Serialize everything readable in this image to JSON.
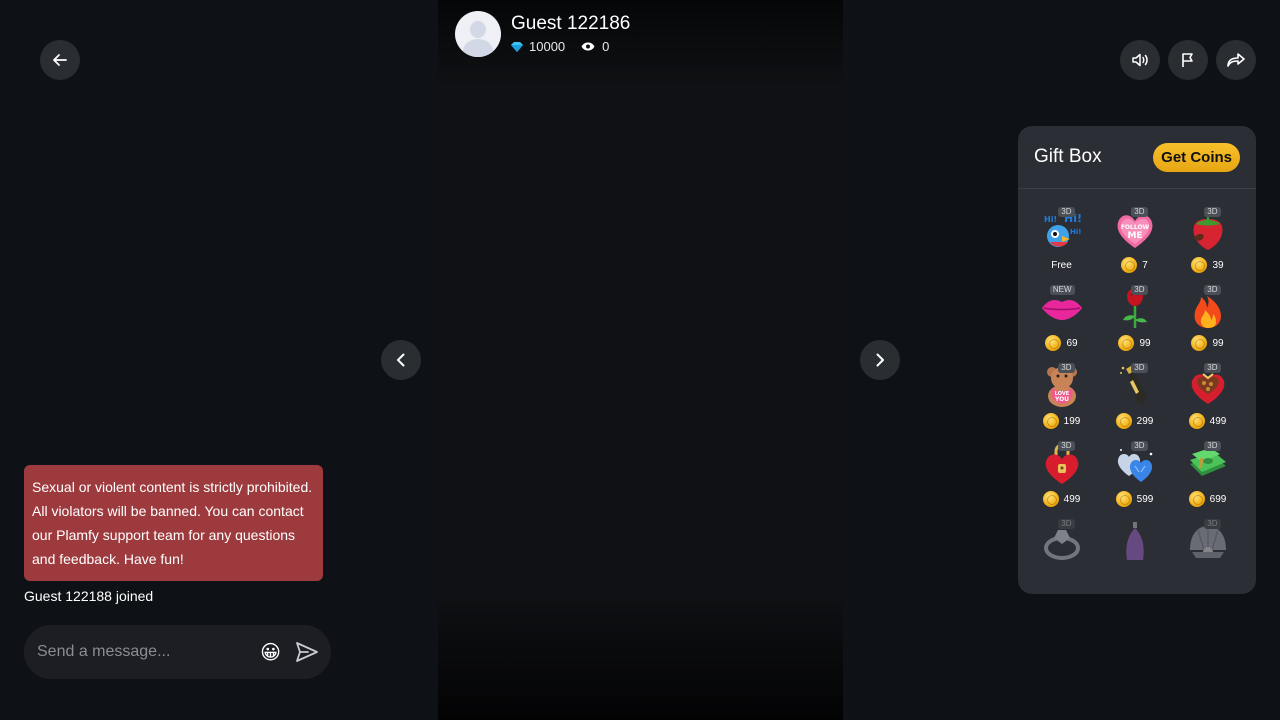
{
  "header": {
    "name": "Guest 122186",
    "diamonds": "10000",
    "viewers": "0"
  },
  "gift_box": {
    "title": "Gift Box",
    "get_coins": "Get Coins",
    "items": [
      {
        "icon": "hi-bird-icon",
        "badge": "3D",
        "price": "Free",
        "coin": false
      },
      {
        "icon": "follow-me-heart-icon",
        "badge": "3D",
        "price": "7",
        "coin": true
      },
      {
        "icon": "strawberry-icon",
        "badge": "3D",
        "price": "39",
        "coin": true
      },
      {
        "icon": "lips-icon",
        "badge": "NEW",
        "price": "69",
        "coin": true
      },
      {
        "icon": "rose-icon",
        "badge": "3D",
        "price": "99",
        "coin": true
      },
      {
        "icon": "fire-icon",
        "badge": "3D",
        "price": "99",
        "coin": true
      },
      {
        "icon": "teddy-bear-icon",
        "badge": "3D",
        "price": "199",
        "coin": true
      },
      {
        "icon": "champagne-icon",
        "badge": "3D",
        "price": "299",
        "coin": true
      },
      {
        "icon": "heart-gift-box-icon",
        "badge": "3D",
        "price": "499",
        "coin": true
      },
      {
        "icon": "heart-lock-icon",
        "badge": "3D",
        "price": "499",
        "coin": true
      },
      {
        "icon": "diamond-hearts-icon",
        "badge": "3D",
        "price": "599",
        "coin": true
      },
      {
        "icon": "money-stack-icon",
        "badge": "3D",
        "price": "699",
        "coin": true
      },
      {
        "icon": "ring-icon",
        "badge": "3D",
        "price": "",
        "coin": false
      },
      {
        "icon": "perfume-icon",
        "badge": "",
        "price": "",
        "coin": false
      },
      {
        "icon": "pearl-shell-icon",
        "badge": "3D",
        "price": "",
        "coin": false
      }
    ]
  },
  "chat": {
    "notice": "Sexual or violent content is strictly prohibited. All violators will be banned. You can contact our Plamfy support team for any questions and feedback. Have fun!",
    "joined": "Guest 122188 joined",
    "placeholder": "Send a message...",
    "emoji": "😀"
  },
  "colors": {
    "background": "#0e1115",
    "panel": "#2b2e34",
    "notice": "#9d3a3e",
    "coin_button": "#f2b31e"
  }
}
